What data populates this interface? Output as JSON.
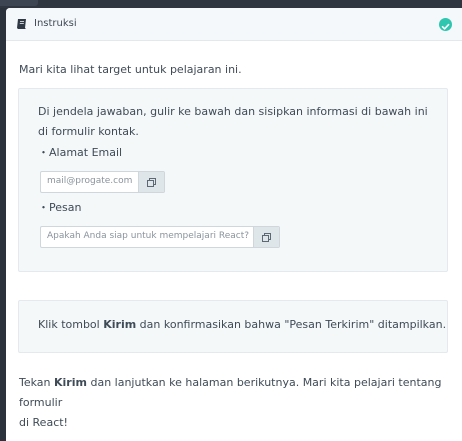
{
  "header": {
    "title": "Instruksi",
    "icons": {
      "left": "book-icon",
      "right": "check-circle-icon"
    },
    "accent": "#2ec6ae"
  },
  "intro": "Mari kita lihat target untuk pelajaran ini.",
  "target_box": {
    "instruction": "Di jendela jawaban, gulir ke bawah dan sisipkan informasi di bawah ini di formulir kontak.",
    "items": [
      {
        "label": "・Alamat Email",
        "value": "mail@progate.com",
        "icon": "copy-icon"
      },
      {
        "label": "・Pesan",
        "value": "Apakah Anda siap untuk mempelajari React?",
        "icon": "copy-icon"
      }
    ]
  },
  "step_box": {
    "prefix": "Klik tombol ",
    "bold": "Kirim",
    "suffix": " dan konfirmasikan bahwa \"Pesan Terkirim\" ditampilkan."
  },
  "footer": {
    "prefix": "Tekan ",
    "bold": "Kirim",
    "suffix_line1": " dan lanjutkan ke halaman berikutnya. Mari kita pelajari tentang formulir",
    "line2": "di React!"
  }
}
